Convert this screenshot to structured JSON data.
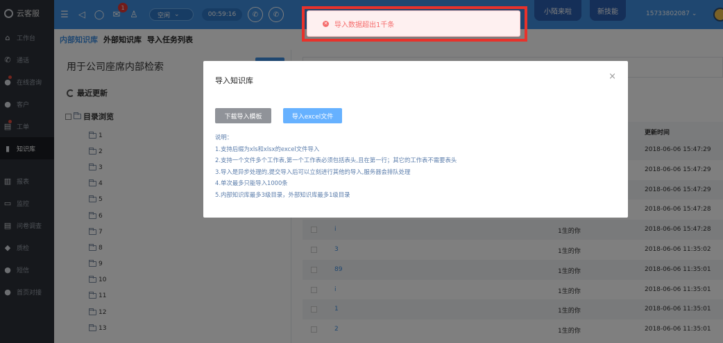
{
  "sidebar": {
    "brand": "云客服",
    "items": [
      {
        "label": "工作台",
        "icon": "home-icon"
      },
      {
        "label": "通话",
        "icon": "phone-icon"
      },
      {
        "label": "在线咨询",
        "icon": "chat-icon"
      },
      {
        "label": "客户",
        "icon": "user-icon"
      },
      {
        "label": "工单",
        "icon": "ticket-icon"
      },
      {
        "label": "知识库",
        "icon": "book-icon"
      },
      {
        "label": "报表",
        "icon": "bar-chart-icon"
      },
      {
        "label": "监控",
        "icon": "monitor-icon"
      },
      {
        "label": "问卷调查",
        "icon": "survey-icon"
      },
      {
        "label": "质检",
        "icon": "shield-icon"
      },
      {
        "label": "短信",
        "icon": "sms-icon"
      },
      {
        "label": "首页对接",
        "icon": "link-icon"
      }
    ]
  },
  "topbar": {
    "notification_count": "1",
    "status": "空闲",
    "timer": "00:59:16",
    "promo_1": "小陌来啦",
    "promo_2": "新技能",
    "phone": "15733802087"
  },
  "tabs": [
    "内部知识库",
    "外部知识库",
    "导入任务列表"
  ],
  "left_panel": {
    "search_title": "用于公司座席内部检索",
    "recent_label": "最近更新",
    "directory_label": "目录浏览",
    "folders": [
      "1",
      "2",
      "3",
      "4",
      "5",
      "6",
      "7",
      "8",
      "9",
      "10",
      "11",
      "12",
      "13"
    ]
  },
  "table": {
    "header_time": "更新时间",
    "rows": [
      {
        "title": "",
        "creator": "",
        "time": "2018-06-06 15:47:29"
      },
      {
        "title": "",
        "creator": "",
        "time": "2018-06-06 15:47:29"
      },
      {
        "title": "",
        "creator": "",
        "time": "2018-06-06 15:47:29"
      },
      {
        "title": "",
        "creator": "",
        "time": "2018-06-06 15:47:28"
      },
      {
        "title": "i",
        "creator": "1生的你",
        "time": "2018-06-06 15:47:28"
      },
      {
        "title": "3",
        "creator": "1生的你",
        "time": "2018-06-06 11:35:02"
      },
      {
        "title": "89",
        "creator": "1生的你",
        "time": "2018-06-06 11:35:01"
      },
      {
        "title": "i",
        "creator": "1生的你",
        "time": "2018-06-06 11:35:01"
      },
      {
        "title": "1",
        "creator": "1生的你",
        "time": "2018-06-06 11:35:01"
      },
      {
        "title": "2",
        "creator": "1生的你",
        "time": "2018-06-06 11:35:01"
      }
    ]
  },
  "modal": {
    "title": "导入知识库",
    "close": "×",
    "download_button": "下载导入模板",
    "import_button": "导入excel文件",
    "desc_title": "说明：",
    "lines": [
      "1.支持后缀为xls和xlsx的excel文件导入",
      "2.支持一个文件多个工作表,第一个工作表必须包括表头,且在第一行；其它的工作表不需要表头",
      "3.导入是异步处理的,提交导入后可以立刻进行其他的导入,服务器会排队处理",
      "4.单次最多只能导入1000条",
      "5.内部知识库最多3级目录，外部知识库最多1级目录"
    ]
  },
  "toast": {
    "message": "导入数据超出1千条"
  }
}
